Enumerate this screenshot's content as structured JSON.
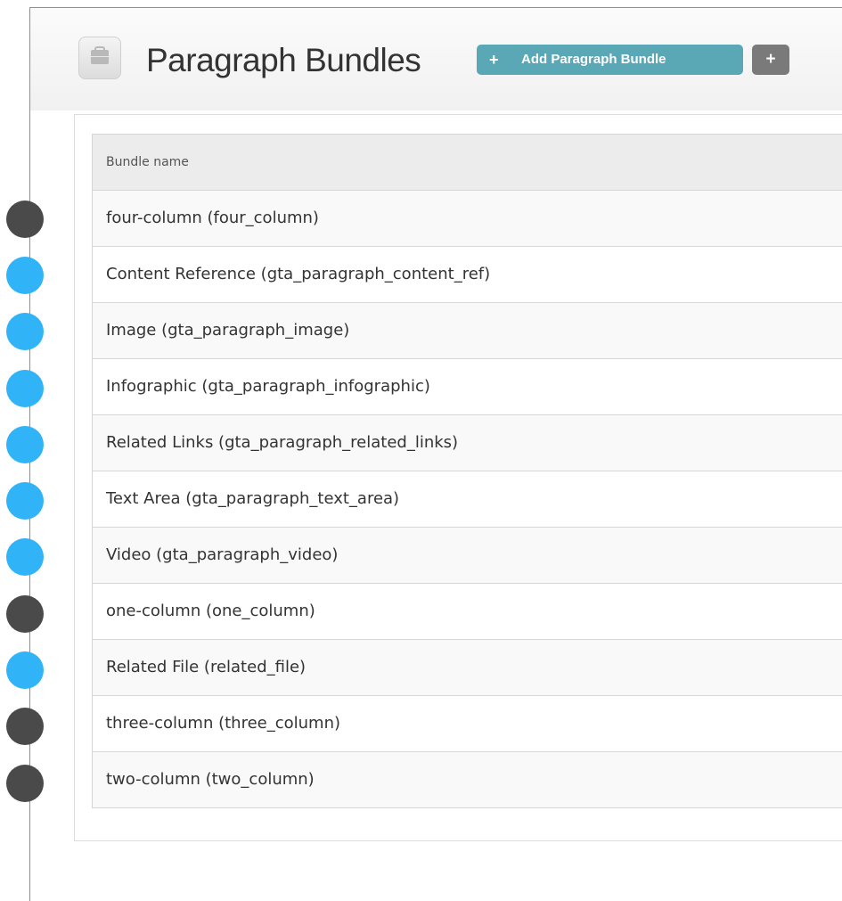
{
  "header": {
    "title": "Paragraph Bundles",
    "add_button": {
      "plus": "+",
      "label": "Add Paragraph Bundle"
    },
    "more_button": "+",
    "page_icon": "bundle-icon"
  },
  "table": {
    "column_header": "Bundle name",
    "rows": [
      "four-column (four_column)",
      "Content Reference (gta_paragraph_content_ref)",
      "Image (gta_paragraph_image)",
      "Infographic (gta_paragraph_infographic)",
      "Related Links (gta_paragraph_related_links)",
      "Text Area (gta_paragraph_text_area)",
      "Video (gta_paragraph_video)",
      "one-column (one_column)",
      "Related File (related_file)",
      "three-column (three_column)",
      "two-column (two_column)"
    ]
  },
  "markers": [
    "dark",
    "blue",
    "blue",
    "blue",
    "blue",
    "blue",
    "blue",
    "dark",
    "blue",
    "dark",
    "dark"
  ],
  "colors": {
    "marker_dark": "#4a4a4a",
    "marker_blue": "#31b3f7",
    "add_button": "#5aa7b6",
    "more_button": "#7a7a7a"
  }
}
